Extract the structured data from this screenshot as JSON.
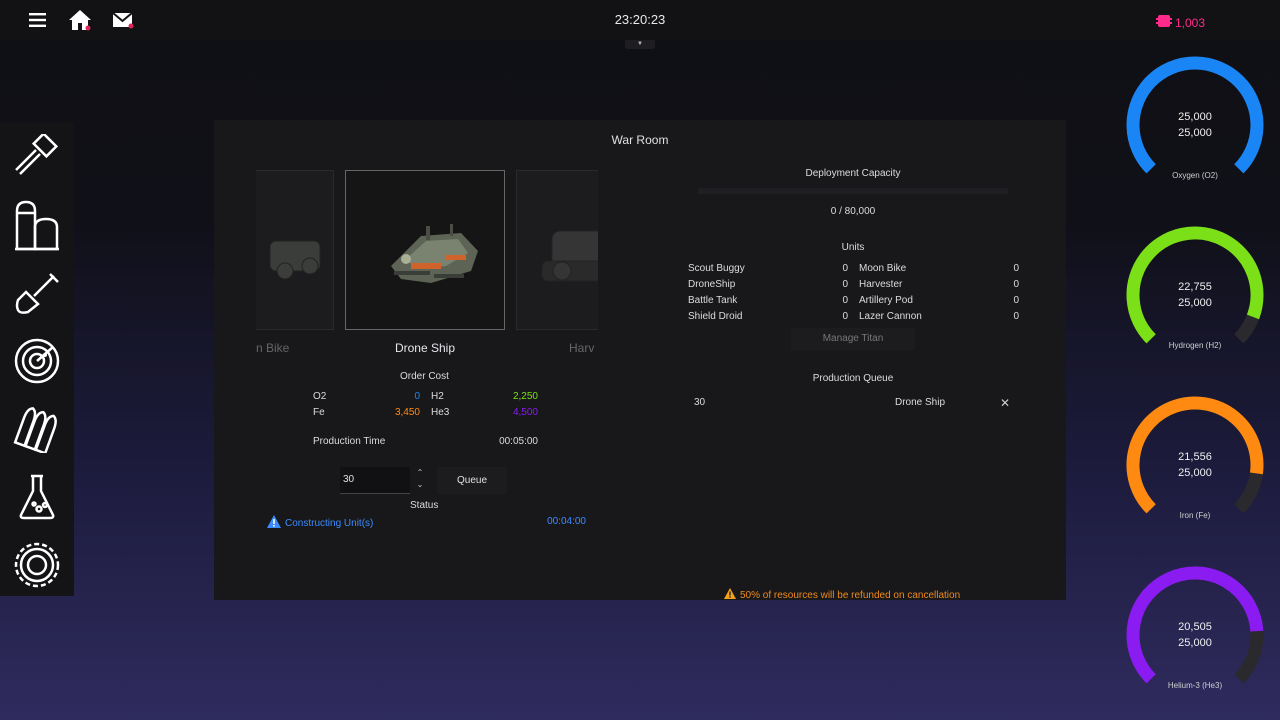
{
  "topbar": {
    "clock": "23:20:23",
    "currency_value": "1,003",
    "currency_color": "#ff2a8a",
    "icons": [
      "menu-icon",
      "home-icon",
      "mail-icon",
      "credits-icon"
    ]
  },
  "sidebar": {
    "items": [
      {
        "icon": "hammer-icon"
      },
      {
        "icon": "silo-icon"
      },
      {
        "icon": "shovel-icon"
      },
      {
        "icon": "radar-icon"
      },
      {
        "icon": "ammo-icon"
      },
      {
        "icon": "flask-icon"
      },
      {
        "icon": "gear-icon"
      }
    ]
  },
  "panel": {
    "title": "War Room",
    "carousel": {
      "prev_label": "n Bike",
      "current_label": "Drone Ship",
      "next_label": "Harv"
    },
    "order_cost": {
      "title": "Order Cost",
      "o2_label": "O2",
      "o2_value": "0",
      "h2_label": "H2",
      "h2_value": "2,250",
      "fe_label": "Fe",
      "fe_value": "3,450",
      "he3_label": "He3",
      "he3_value": "4,500"
    },
    "production_time": {
      "label": "Production Time",
      "value": "00:05:00"
    },
    "quantity_input": "30",
    "queue_button": "Queue",
    "status": {
      "title": "Status",
      "text": "Constructing Unit(s)",
      "time": "00:04:00"
    },
    "deployment": {
      "title": "Deployment Capacity",
      "value": "0 / 80,000"
    },
    "units": {
      "title": "Units",
      "left": [
        {
          "name": "Scout Buggy",
          "count": "0"
        },
        {
          "name": "DroneShip",
          "count": "0"
        },
        {
          "name": "Battle Tank",
          "count": "0"
        },
        {
          "name": "Shield Droid",
          "count": "0"
        }
      ],
      "right": [
        {
          "name": "Moon Bike",
          "count": "0"
        },
        {
          "name": "Harvester",
          "count": "0"
        },
        {
          "name": "Artillery Pod",
          "count": "0"
        },
        {
          "name": "Lazer Cannon",
          "count": "0"
        }
      ]
    },
    "manage_titan": "Manage Titan",
    "production_queue": {
      "title": "Production Queue",
      "rows": [
        {
          "qty": "30",
          "unit": "Drone Ship"
        }
      ]
    },
    "refund_notice": "50% of resources will be refunded on cancellation"
  },
  "resources": [
    {
      "name": "Oxygen (O2)",
      "current": "25,000",
      "max": "25,000",
      "fraction": 1.0,
      "color": "#1a86f5"
    },
    {
      "name": "Hydrogen (H2)",
      "current": "22,755",
      "max": "25,000",
      "fraction": 0.91,
      "color": "#7be017"
    },
    {
      "name": "Iron (Fe)",
      "current": "21,556",
      "max": "25,000",
      "fraction": 0.862,
      "color": "#ff8a12"
    },
    {
      "name": "Helium-3 (He3)",
      "current": "20,505",
      "max": "25,000",
      "fraction": 0.82,
      "color": "#8a1cf2"
    }
  ],
  "colors": {
    "o2": "#1a86f5",
    "h2": "#7be017",
    "fe": "#ff8a12",
    "he3": "#8a1cf2",
    "status": "#3a8cff",
    "warning": "#f08a1a"
  }
}
